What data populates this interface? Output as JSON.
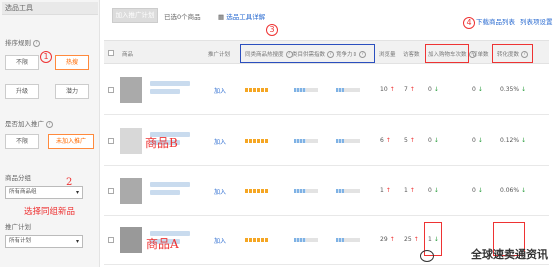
{
  "sidebar": {
    "title": "选品工具",
    "sort_label": "排序规则",
    "sort_buttons": [
      "不限",
      "热搜",
      "升级",
      "潜力"
    ],
    "promo_label": "是否加入推广",
    "promo_buttons": [
      "不限",
      "未加入推广"
    ],
    "group_label": "商品分组",
    "group_value": "所有商品组",
    "plan_label": "推广计划",
    "plan_value": "所有计划"
  },
  "annotations": {
    "circle1": "1",
    "circle3": "3",
    "circle4": "4",
    "note2": "2",
    "note2_text": "选择同组新品",
    "product_b": "商品B",
    "product_a": "商品A",
    "watermark": "全球速卖通资讯"
  },
  "toolbar": {
    "add_button": "加入推广计划",
    "selected_text": "已选0个商品",
    "link_text": "选品工具详解",
    "right_link1": "下载商品列表",
    "right_link2": "列表项设置"
  },
  "table": {
    "headers": [
      "商品",
      "推广计划",
      "同类商品热搜度",
      "类目供需指数",
      "竞争力",
      "浏览量",
      "访客数",
      "加入购物车次数",
      "订单数",
      "转化度数"
    ],
    "rows": [
      {
        "plan": "加入",
        "hot": 1,
        "supply": 0.5,
        "compete": 0.35,
        "views": "10",
        "visitors": "7",
        "cart": "0",
        "orders": "0",
        "conv": "0.35%"
      },
      {
        "plan": "加入",
        "hot": 1,
        "supply": 0.5,
        "compete": 0.35,
        "views": "6",
        "visitors": "5",
        "cart": "0",
        "orders": "0",
        "conv": "0.12%"
      },
      {
        "plan": "加入",
        "hot": 1,
        "supply": 0.5,
        "compete": 0.35,
        "views": "1",
        "visitors": "1",
        "cart": "0",
        "orders": "0",
        "conv": "0.06%"
      },
      {
        "plan": "加入",
        "hot": 1,
        "supply": 0.5,
        "compete": 0.35,
        "views": "29",
        "visitors": "25",
        "cart": "1",
        "orders": "",
        "conv": ""
      }
    ]
  },
  "colors": {
    "accent_red": "#e33333",
    "blue_box": "#2b4fbf",
    "link": "#2a6bd1",
    "orange": "#ff6a00"
  }
}
